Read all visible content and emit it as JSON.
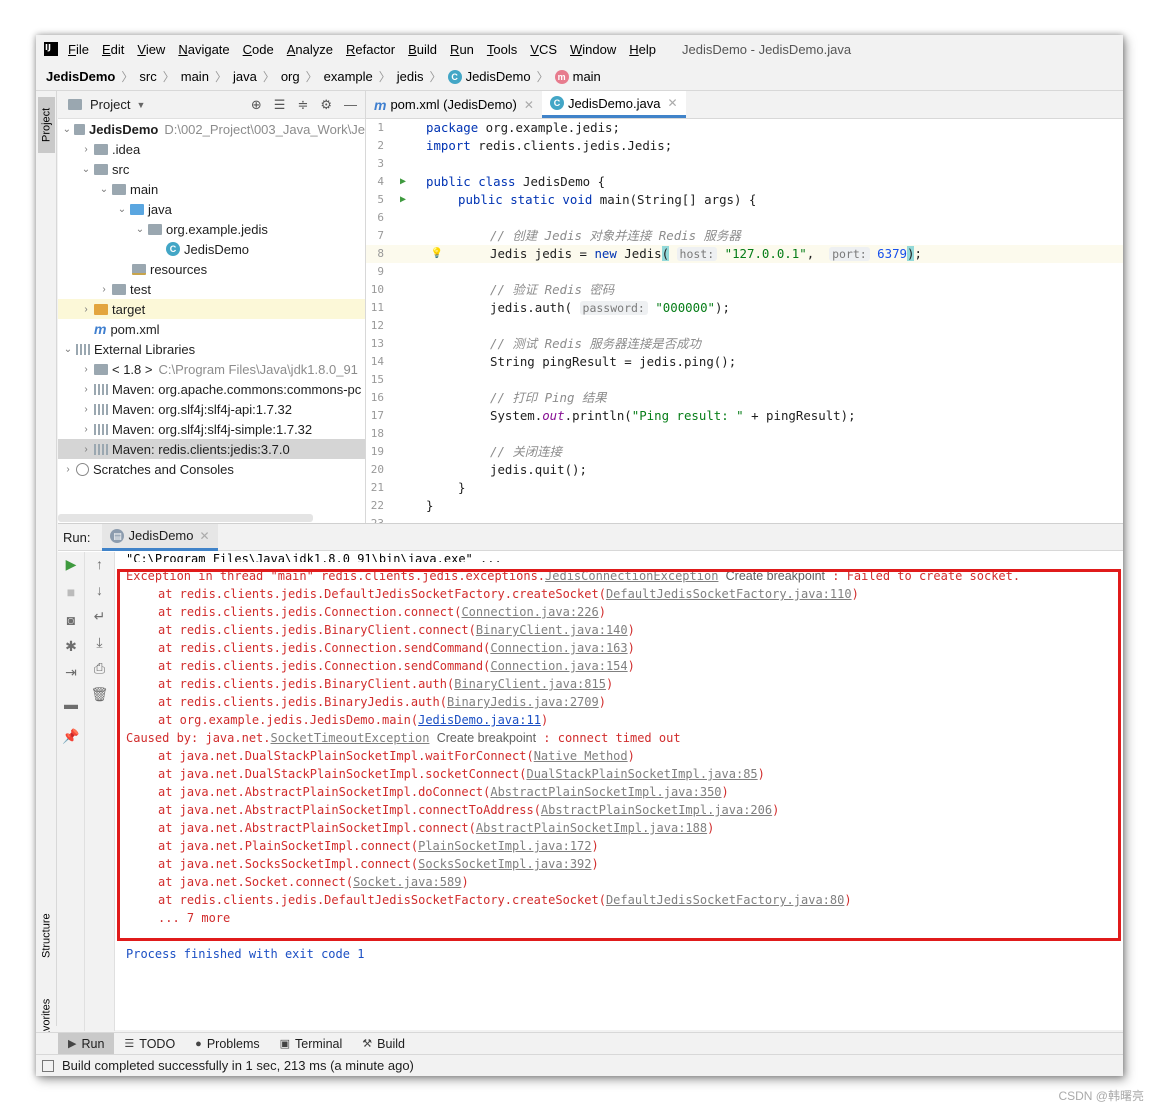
{
  "menu": {
    "items": [
      "File",
      "Edit",
      "View",
      "Navigate",
      "Code",
      "Analyze",
      "Refactor",
      "Build",
      "Run",
      "Tools",
      "VCS",
      "Window",
      "Help"
    ],
    "window_title": "JedisDemo - JedisDemo.java"
  },
  "breadcrumb": [
    "JedisDemo",
    "src",
    "main",
    "java",
    "org",
    "example",
    "jedis",
    "JedisDemo",
    "main"
  ],
  "left_strip": {
    "project": "Project",
    "structure": "Structure",
    "favorites": "Favorites"
  },
  "project": {
    "title": "Project",
    "tree": [
      {
        "label": "JedisDemo",
        "extra": "D:\\002_Project\\003_Java_Work\\Je"
      },
      {
        "label": ".idea"
      },
      {
        "label": "src"
      },
      {
        "label": "main"
      },
      {
        "label": "java"
      },
      {
        "label": "org.example.jedis"
      },
      {
        "label": "JedisDemo"
      },
      {
        "label": "resources"
      },
      {
        "label": "test"
      },
      {
        "label": "target"
      },
      {
        "label": "pom.xml"
      },
      {
        "label": "External Libraries"
      },
      {
        "label": "< 1.8 >",
        "extra": "C:\\Program Files\\Java\\jdk1.8.0_91"
      },
      {
        "label": "Maven: org.apache.commons:commons-pc"
      },
      {
        "label": "Maven: org.slf4j:slf4j-api:1.7.32"
      },
      {
        "label": "Maven: org.slf4j:slf4j-simple:1.7.32"
      },
      {
        "label": "Maven: redis.clients:jedis:3.7.0"
      },
      {
        "label": "Scratches and Consoles"
      }
    ]
  },
  "editor": {
    "tabs": [
      "pom.xml (JedisDemo)",
      "JedisDemo.java"
    ],
    "line_numbers": [
      "1",
      "2",
      "3",
      "4",
      "5",
      "6",
      "7",
      "8",
      "9",
      "10",
      "11",
      "12",
      "13",
      "14",
      "15",
      "16",
      "17",
      "18",
      "19",
      "20",
      "21",
      "22",
      "23"
    ],
    "code": {
      "l1_kw": "package",
      "l1_rest": " org.example.jedis;",
      "l2_kw": "import",
      "l2_rest": " redis.clients.jedis.Jedis;",
      "l4_kw": "public class",
      "l4_rest": " JedisDemo {",
      "l5_kw": "public static void",
      "l5_rest": " main(String[] args) {",
      "l7": "// 创建 Jedis 对象并连接 Redis 服务器",
      "l8_a": "Jedis jedis = ",
      "l8_new": "new",
      "l8_b": " Jedis",
      "l8_hint_host": "host:",
      "l8_str": "\"127.0.0.1\"",
      "l8_hint_port": "port:",
      "l8_num": "6379",
      "l8_end": ";",
      "l10": "// 验证 Redis 密码",
      "l11_a": "jedis.auth(",
      "l11_hint": "password:",
      "l11_str": "\"000000\"",
      "l11_end": ");",
      "l13": "// 测试 Redis 服务器连接是否成功",
      "l14": "String pingResult = jedis.ping();",
      "l16": "// 打印 Ping 结果",
      "l17_a": "System.",
      "l17_out": "out",
      "l17_b": ".println(",
      "l17_str": "\"Ping result: \"",
      "l17_c": " + pingResult);",
      "l19": "// 关闭连接",
      "l20": "jedis.quit();",
      "l21": "}",
      "l22": "}"
    }
  },
  "run": {
    "label": "Run:",
    "tab": "JedisDemo",
    "cmd": "\"C:\\Program Files\\Java\\jdk1.8.0_91\\bin\\java.exe\" ...",
    "exception": {
      "prefix": "Exception in thread \"main\" redis.clients.jedis.exceptions.",
      "cls": "JedisConnectionException",
      "bp": "Create breakpoint",
      "msg": " : Failed to create socket."
    },
    "frames1": [
      {
        "at": "at redis.clients.jedis.DefaultJedisSocketFactory.createSocket",
        "loc": "DefaultJedisSocketFactory.java:110"
      },
      {
        "at": "at redis.clients.jedis.Connection.connect",
        "loc": "Connection.java:226"
      },
      {
        "at": "at redis.clients.jedis.BinaryClient.connect",
        "loc": "BinaryClient.java:140"
      },
      {
        "at": "at redis.clients.jedis.Connection.sendCommand",
        "loc": "Connection.java:163"
      },
      {
        "at": "at redis.clients.jedis.Connection.sendCommand",
        "loc": "Connection.java:154"
      },
      {
        "at": "at redis.clients.jedis.BinaryClient.auth",
        "loc": "BinaryClient.java:815"
      },
      {
        "at": "at redis.clients.jedis.BinaryJedis.auth",
        "loc": "BinaryJedis.java:2709"
      },
      {
        "at": "at org.example.jedis.JedisDemo.main",
        "loc": "JedisDemo.java:11"
      }
    ],
    "caused": {
      "prefix": "Caused by: java.net.",
      "cls": "SocketTimeoutException",
      "bp": "Create breakpoint",
      "msg": " : connect timed out"
    },
    "frames2": [
      {
        "at": "at java.net.DualStackPlainSocketImpl.waitForConnect",
        "loc": "Native Method"
      },
      {
        "at": "at java.net.DualStackPlainSocketImpl.socketConnect",
        "loc": "DualStackPlainSocketImpl.java:85"
      },
      {
        "at": "at java.net.AbstractPlainSocketImpl.doConnect",
        "loc": "AbstractPlainSocketImpl.java:350"
      },
      {
        "at": "at java.net.AbstractPlainSocketImpl.connectToAddress",
        "loc": "AbstractPlainSocketImpl.java:206"
      },
      {
        "at": "at java.net.AbstractPlainSocketImpl.connect",
        "loc": "AbstractPlainSocketImpl.java:188"
      },
      {
        "at": "at java.net.PlainSocketImpl.connect",
        "loc": "PlainSocketImpl.java:172"
      },
      {
        "at": "at java.net.SocksSocketImpl.connect",
        "loc": "SocksSocketImpl.java:392"
      },
      {
        "at": "at java.net.Socket.connect",
        "loc": "Socket.java:589"
      },
      {
        "at": "at redis.clients.jedis.DefaultJedisSocketFactory.createSocket",
        "loc": "DefaultJedisSocketFactory.java:80"
      }
    ],
    "more": "... 7 more",
    "finished": "Process finished with exit code 1"
  },
  "bottom_tabs": [
    "Run",
    "TODO",
    "Problems",
    "Terminal",
    "Build"
  ],
  "status": "Build completed successfully in 1 sec, 213 ms (a minute ago)",
  "watermark": "CSDN @韩曙亮",
  "colors": {
    "accent": "#4083c9",
    "error_text": "#d12c2c",
    "highlight_box": "#e01b1b",
    "keyword": "#0033b3",
    "string": "#067d17"
  }
}
